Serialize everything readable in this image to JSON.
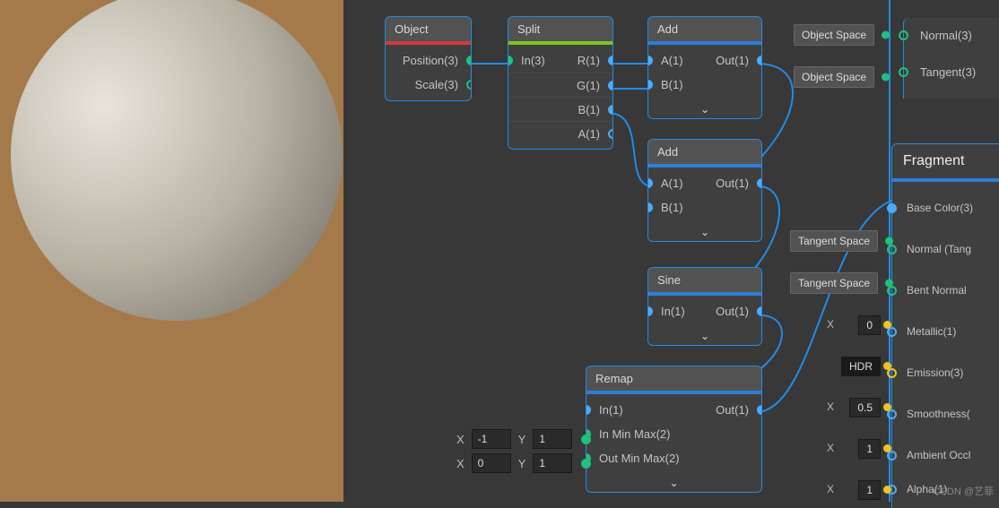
{
  "preview": {
    "shape": "sphere"
  },
  "nodes": {
    "object": {
      "title": "Object",
      "stripe": "red",
      "ports": [
        {
          "label": "Position(3)",
          "side": "out"
        },
        {
          "label": "Scale(3)",
          "side": "out"
        }
      ]
    },
    "split": {
      "title": "Split",
      "stripe": "green",
      "in": [
        {
          "label": "In(3)"
        }
      ],
      "out": [
        {
          "label": "R(1)"
        },
        {
          "label": "G(1)"
        },
        {
          "label": "B(1)"
        },
        {
          "label": "A(1)"
        }
      ]
    },
    "add1": {
      "title": "Add",
      "stripe": "blue",
      "in": [
        {
          "label": "A(1)"
        },
        {
          "label": "B(1)"
        }
      ],
      "out": [
        {
          "label": "Out(1)"
        }
      ]
    },
    "add2": {
      "title": "Add",
      "stripe": "blue",
      "in": [
        {
          "label": "A(1)"
        },
        {
          "label": "B(1)"
        }
      ],
      "out": [
        {
          "label": "Out(1)"
        }
      ]
    },
    "sine": {
      "title": "Sine",
      "stripe": "blue",
      "in": [
        {
          "label": "In(1)"
        }
      ],
      "out": [
        {
          "label": "Out(1)"
        }
      ]
    },
    "remap": {
      "title": "Remap",
      "stripe": "blue",
      "in": [
        {
          "label": "In(1)"
        },
        {
          "label": "In Min Max(2)"
        },
        {
          "label": "Out Min Max(2)"
        }
      ],
      "out": [
        {
          "label": "Out(1)"
        }
      ],
      "fields": {
        "inMinMax": {
          "x": "-1",
          "y": "1"
        },
        "outMinMax": {
          "x": "0",
          "y": "1"
        }
      }
    }
  },
  "pills": {
    "objectSpace1": "Object Space",
    "objectSpace2": "Object Space",
    "tangentSpace1": "Tangent Space",
    "tangentSpace2": "Tangent Space"
  },
  "topPorts": {
    "normal": "Normal(3)",
    "tangent": "Tangent(3)"
  },
  "fragment": {
    "title": "Fragment",
    "rows": [
      {
        "label": "Base Color(3)",
        "filled": true
      },
      {
        "label": "Normal (Tang",
        "field": null,
        "pill": "tangentSpace1"
      },
      {
        "label": "Bent Normal",
        "pill": "tangentSpace2"
      },
      {
        "label": "Metallic(1)",
        "fieldX": "0"
      },
      {
        "label": "Emission(3)",
        "hdr": "HDR"
      },
      {
        "label": "Smoothness(",
        "fieldX": "0.5"
      },
      {
        "label": "Ambient Occl",
        "fieldX": "1"
      },
      {
        "label": "Alpha(1)",
        "fieldX": "1"
      }
    ]
  },
  "watermark": "CSDN @艺菲"
}
